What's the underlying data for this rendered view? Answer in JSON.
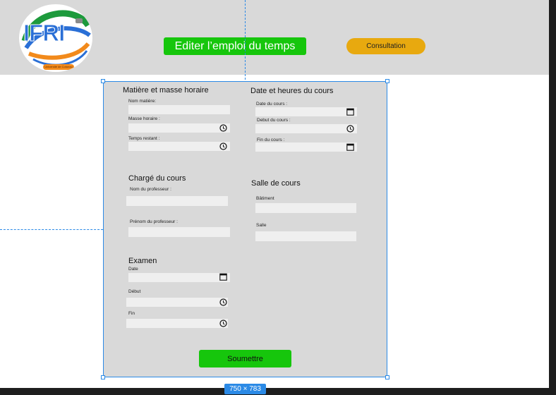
{
  "logo": {
    "text": "IFRI",
    "badge_text": "Université de Cotonou"
  },
  "header": {
    "edit_button": "Editer l’emploi du temps",
    "consult_button": "Consultation"
  },
  "sections": {
    "matiere": {
      "title": "Matière et masse horaire",
      "nom_label": "Nom matière:",
      "masse_label": "Masse horaire :",
      "temps_label": "Temps restant :"
    },
    "date": {
      "title": "Date et heures du cours",
      "date_label": "Date du cours :",
      "debut_label": "Debut du cours :",
      "fin_label": "Fin  du cours :"
    },
    "charge": {
      "title": "Chargé du cours",
      "nom_label": "Nom du professeur :",
      "prenom_label": "Prénom du professeur :"
    },
    "salle": {
      "title": "Salle de cours",
      "batiment_label": "Bâtiment",
      "salle_label": "Salle"
    },
    "examen": {
      "title": "Examen",
      "date_label": "Date",
      "debut_label": "Début",
      "fin_label": "Fin"
    }
  },
  "submit_button": "Soumettre",
  "frame_size_label": "750 × 783",
  "colors": {
    "green": "#16c60c",
    "orange": "#e8a90f",
    "selection_blue": "#2b8ae6",
    "panel_gray": "#d9d9d9"
  },
  "icons": {
    "clock": "clock-icon",
    "calendar": "calendar-icon"
  }
}
